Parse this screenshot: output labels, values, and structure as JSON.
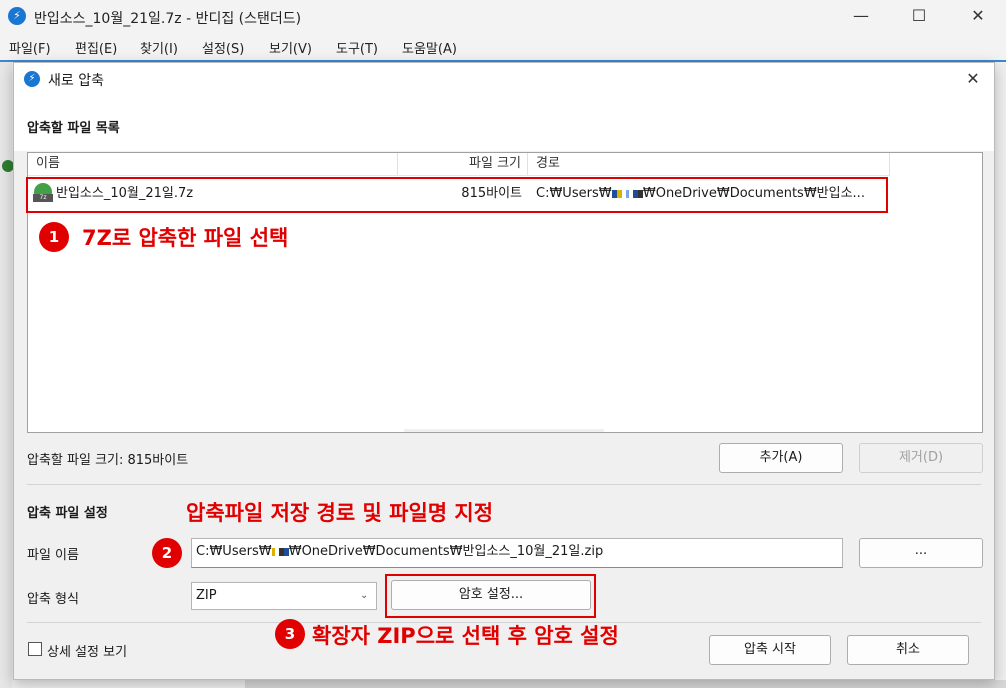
{
  "window": {
    "title": "반입소스_10월_21일.7z - 반디집 (스탠더드)",
    "controls": {
      "minimize": "—",
      "maximize": "☐",
      "close": "✕"
    }
  },
  "menu": [
    "파일(F)",
    "편집(E)",
    "찾기(I)",
    "설정(S)",
    "보기(V)",
    "도구(T)",
    "도움말(A)"
  ],
  "dialog": {
    "title": "새로 압축",
    "close": "✕",
    "list_section_title": "압축할 파일 목록",
    "columns": [
      "이름",
      "파일 크기",
      "경로"
    ],
    "rows": [
      {
        "name": "반입소스_10월_21일.7z",
        "size": "815바이트",
        "path_prefix": "C:₩Users₩",
        "path_suffix": "₩OneDrive₩Documents₩반입소..."
      }
    ],
    "total_size_label": "압축할 파일 크기: 815바이트",
    "add_button": "추가(A)",
    "remove_button": "제거(D)",
    "settings_section_title": "압축 파일 설정",
    "filename_label": "파일 이름",
    "filename_prefix": "C:₩Users₩",
    "filename_suffix": "₩OneDrive₩Documents₩반입소스_10월_21일.zip",
    "browse_button": "...",
    "format_label": "압축 형식",
    "format_value": "ZIP",
    "password_button": "암호 설정...",
    "advanced_label": "상세 설정 보기",
    "start_button": "압축 시작",
    "cancel_button": "취소"
  },
  "annotations": {
    "step1_number": "1",
    "step1_text": "7Z로 압축한 파일 선택",
    "step2_number": "2",
    "step2_text": "압축파일 저장 경로 및 파일명 지정",
    "step3_number": "3",
    "step3_text": "확장자 ZIP으로 선택 후 암호 설정"
  },
  "colors": {
    "accent": "#3a88d4",
    "annotation_red": "#e10000",
    "file_icon": "#43a047"
  }
}
